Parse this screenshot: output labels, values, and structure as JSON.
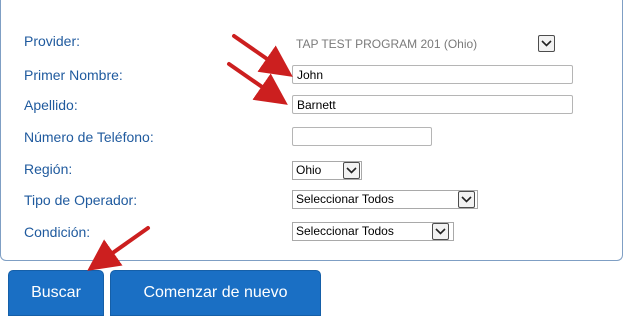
{
  "form": {
    "provider": {
      "label": "Provider:",
      "selected": "TAP TEST PROGRAM 201 (Ohio)",
      "icon": "chevron-down-icon"
    },
    "first_name": {
      "label": "Primer Nombre:",
      "value": "John"
    },
    "last_name": {
      "label": "Apellido:",
      "value": "Barnett"
    },
    "phone": {
      "label": "Número de Teléfono:",
      "value": ""
    },
    "region": {
      "label": "Región:",
      "selected": "Ohio",
      "icon": "chevron-down-icon"
    },
    "operator_type": {
      "label": "Tipo de Operador:",
      "selected": "Seleccionar Todos",
      "icon": "chevron-down-icon"
    },
    "condition": {
      "label": "Condición:",
      "selected": "Seleccionar Todos",
      "icon": "chevron-down-icon"
    }
  },
  "buttons": {
    "search_label": "Buscar",
    "reset_label": "Comenzar de nuevo"
  },
  "colors": {
    "label_blue": "#1f5a9e",
    "button_blue": "#1a6fc4",
    "arrow_red": "#cc1f1f"
  }
}
